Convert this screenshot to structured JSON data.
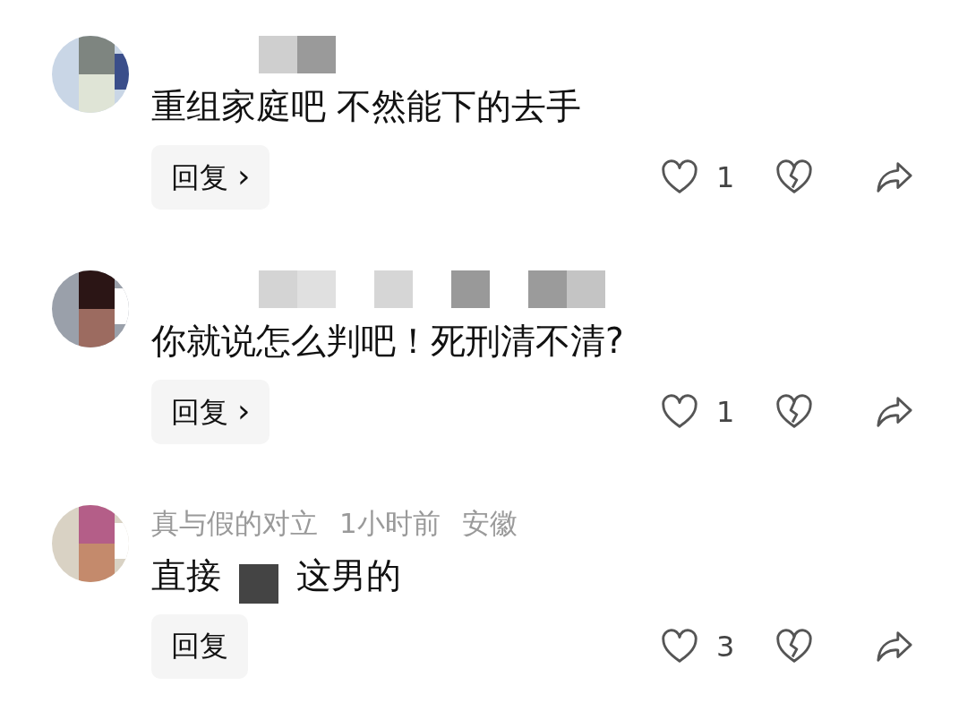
{
  "comments": [
    {
      "author_censored": true,
      "body": [
        {
          "kind": "text",
          "text": "重组家庭吧 不然能下的去手"
        }
      ],
      "reply": {
        "label": "回复",
        "chevron": "›"
      },
      "likes": "1"
    },
    {
      "author_censored": true,
      "body": [
        {
          "kind": "text",
          "text": "你就说怎么判吧！死刑清不清?"
        }
      ],
      "reply": {
        "label": "回复",
        "chevron": "›"
      },
      "likes": "1"
    },
    {
      "author": "真与假的对立",
      "author_censored": false,
      "meta": [
        "1小时前",
        "安徽"
      ],
      "body": [
        {
          "kind": "text",
          "text": "直接"
        },
        {
          "kind": "censor"
        },
        {
          "kind": "text",
          "text": "这男的"
        }
      ],
      "reply": {
        "label": "回复"
      },
      "likes": "3"
    }
  ]
}
